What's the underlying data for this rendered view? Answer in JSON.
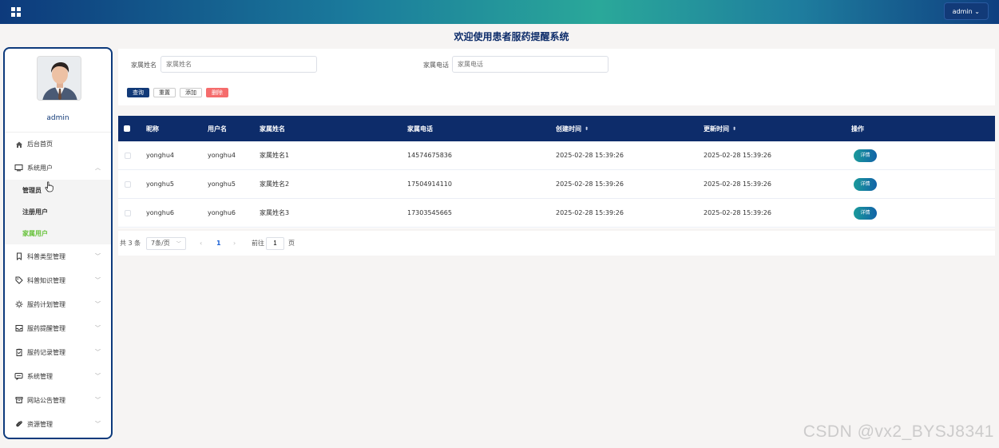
{
  "header": {
    "user_label": "admin"
  },
  "page_title": "欢迎使用患者服药提醒系统",
  "sidebar": {
    "user_name": "admin",
    "items": [
      {
        "label": "后台首页",
        "icon": "home-icon"
      },
      {
        "label": "系统用户",
        "icon": "monitor-icon",
        "expanded": true,
        "children": [
          {
            "label": "管理员"
          },
          {
            "label": "注册用户"
          },
          {
            "label": "家属用户",
            "active": true
          }
        ]
      },
      {
        "label": "科普类型管理",
        "icon": "bookmark-icon"
      },
      {
        "label": "科普知识管理",
        "icon": "tag-icon"
      },
      {
        "label": "服药计划管理",
        "icon": "sun-icon"
      },
      {
        "label": "服药提醒管理",
        "icon": "inbox-icon"
      },
      {
        "label": "服药记录管理",
        "icon": "clipboard-icon"
      },
      {
        "label": "系统管理",
        "icon": "chat-icon"
      },
      {
        "label": "网站公告管理",
        "icon": "box-icon"
      },
      {
        "label": "资源管理",
        "icon": "paperclip-icon"
      }
    ]
  },
  "search": {
    "name_label": "家属姓名",
    "name_placeholder": "家属姓名",
    "phone_label": "家属电话",
    "phone_placeholder": "家属电话",
    "query_label": "查询",
    "reset_label": "重置",
    "add_label": "添加",
    "delete_label": "删除"
  },
  "table": {
    "columns": [
      "昵称",
      "用户名",
      "家属姓名",
      "家属电话",
      "创建时间",
      "更新时间",
      "操作"
    ],
    "sort_icon": "sort-icon",
    "rows": [
      {
        "nickname": "yonghu4",
        "username": "yonghu4",
        "family_name": "家属姓名1",
        "phone": "14574675836",
        "created": "2025-02-28 15:39:26",
        "updated": "2025-02-28 15:39:26",
        "action": "详情"
      },
      {
        "nickname": "yonghu5",
        "username": "yonghu5",
        "family_name": "家属姓名2",
        "phone": "17504914110",
        "created": "2025-02-28 15:39:26",
        "updated": "2025-02-28 15:39:26",
        "action": "详情"
      },
      {
        "nickname": "yonghu6",
        "username": "yonghu6",
        "family_name": "家属姓名3",
        "phone": "17303545665",
        "created": "2025-02-28 15:39:26",
        "updated": "2025-02-28 15:39:26",
        "action": "详情"
      }
    ]
  },
  "pager": {
    "total": "共 3 条",
    "page_size": "7条/页",
    "current_page": "1",
    "goto_label": "前往",
    "goto_value": "1",
    "page_suffix": "页"
  },
  "watermark": "CSDN @vx2_BYSJ8341",
  "colors": {
    "navy": "#0d2c6a",
    "accent_green": "#67c23a",
    "danger": "#f56c6c"
  }
}
